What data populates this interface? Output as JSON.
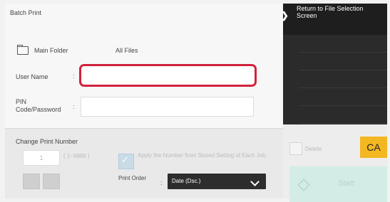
{
  "title": "Batch Print",
  "return_button": {
    "label": "Return to File Selection Screen"
  },
  "folder": {
    "label": "Main Folder",
    "value": "All Files"
  },
  "user_name": {
    "label": "User Name",
    "colon": ":",
    "value": ""
  },
  "pin": {
    "label": "PIN Code/Password",
    "colon": ":",
    "value": ""
  },
  "print_number": {
    "label": "Change Print Number",
    "value": "1",
    "range": "( 1~9999 )",
    "apply_label": "Apply the Number from Stored Setting of Each Job."
  },
  "print_order": {
    "label": "Print Order",
    "colon": ":",
    "value": "Date (Dsc.)"
  },
  "delete": {
    "label": "Delete"
  },
  "ca": {
    "label": "CA"
  },
  "start": {
    "label": "Start"
  },
  "colors": {
    "highlight": "#d0223b",
    "ca_bg": "#f3b722",
    "start_bg": "#d3ede6",
    "dark_panel": "#2b2b2b"
  }
}
